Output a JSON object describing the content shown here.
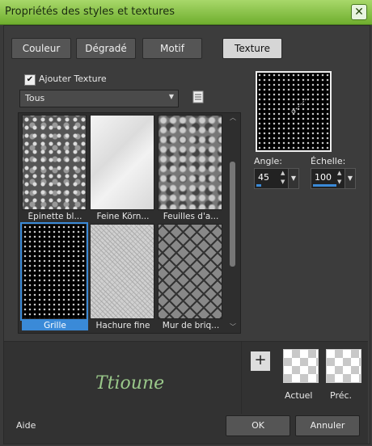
{
  "window": {
    "title": "Propriétés des styles et textures",
    "close_icon": "close-icon"
  },
  "tabs": [
    {
      "label": "Couleur",
      "active": false
    },
    {
      "label": "Dégradé",
      "active": false
    },
    {
      "label": "Motif",
      "active": false
    },
    {
      "label": "Texture",
      "active": true
    }
  ],
  "add_texture": {
    "checked": true,
    "label": "Ajouter Texture"
  },
  "category": {
    "value": "Tous"
  },
  "textures": [
    {
      "caption": "Épinette bl...",
      "pattern": "spruce"
    },
    {
      "caption": "Feine Körn...",
      "pattern": "fine-grain"
    },
    {
      "caption": "Feuilles d'a...",
      "pattern": "leaves"
    },
    {
      "caption": "Grille",
      "pattern": "grid",
      "selected": true
    },
    {
      "caption": "Hachure fine",
      "pattern": "hatch"
    },
    {
      "caption": "Mur de briq...",
      "pattern": "brick"
    }
  ],
  "angle": {
    "label": "Angle:",
    "value": "45",
    "level": 0.125
  },
  "scale": {
    "label": "Échelle:",
    "value": "100",
    "level": 0.6
  },
  "signature": "Ttioune",
  "swatches": {
    "current_label": "Actuel",
    "previous_label": "Préc."
  },
  "footer": {
    "help": "Aide",
    "ok": "OK",
    "cancel": "Annuler"
  },
  "colors": {
    "accent": "#3a8ad8",
    "titlebar": "#8cc44c"
  }
}
